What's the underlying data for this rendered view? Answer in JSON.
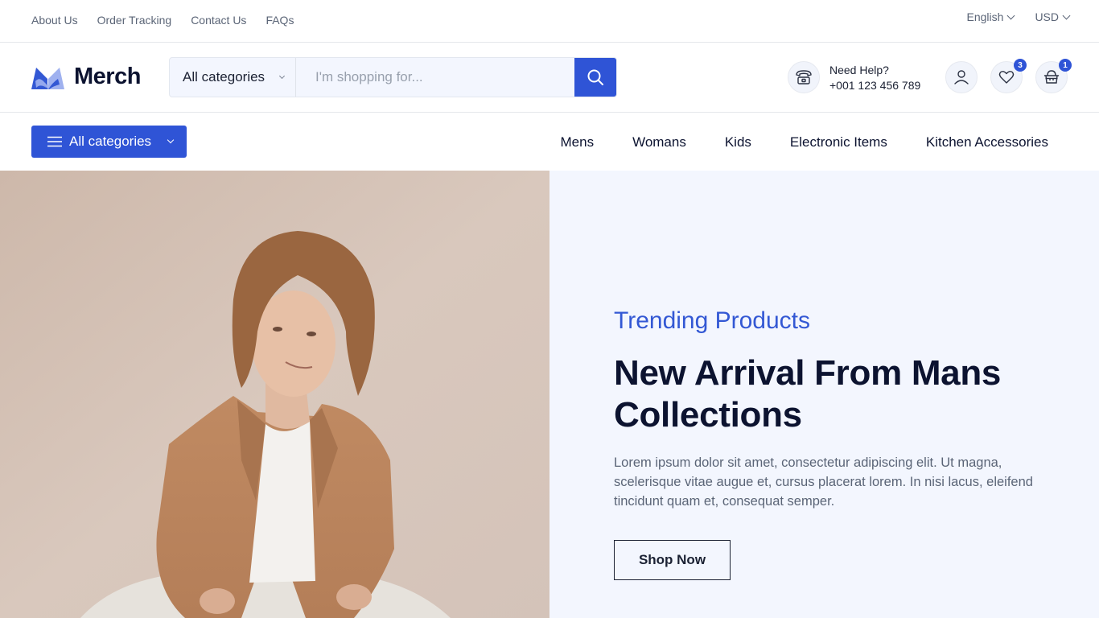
{
  "topbar": {
    "links": [
      "About Us",
      "Order Tracking",
      "Contact Us",
      "FAQs"
    ],
    "language": "English",
    "currency": "USD"
  },
  "header": {
    "logo_text": "Merch",
    "search": {
      "category": "All categories",
      "placeholder": "I'm shopping for..."
    },
    "help": {
      "label": "Need Help?",
      "phone": "+001 123 456 789"
    },
    "wishlist_count": "3",
    "cart_count": "1"
  },
  "nav": {
    "all_categories": "All categories",
    "links": [
      "Mens",
      "Womans",
      "Kids",
      "Electronic Items",
      "Kitchen Accessories"
    ]
  },
  "hero": {
    "eyebrow": "Trending Products",
    "headline": "New Arrival From Mans Collections",
    "description": "Lorem ipsum dolor sit amet, consectetur adipiscing elit. Ut magna, scelerisque vitae augue et, cursus placerat lorem. In nisi lacus, eleifend tincidunt quam et, consequat semper.",
    "cta": "Shop Now",
    "image_alt": "Young man with curly hair in camel blazer and white t-shirt"
  },
  "colors": {
    "accent": "#2f54d6",
    "heading": "#0c1330",
    "muted": "#5b6577",
    "panel_bg": "#f3f6fe"
  }
}
